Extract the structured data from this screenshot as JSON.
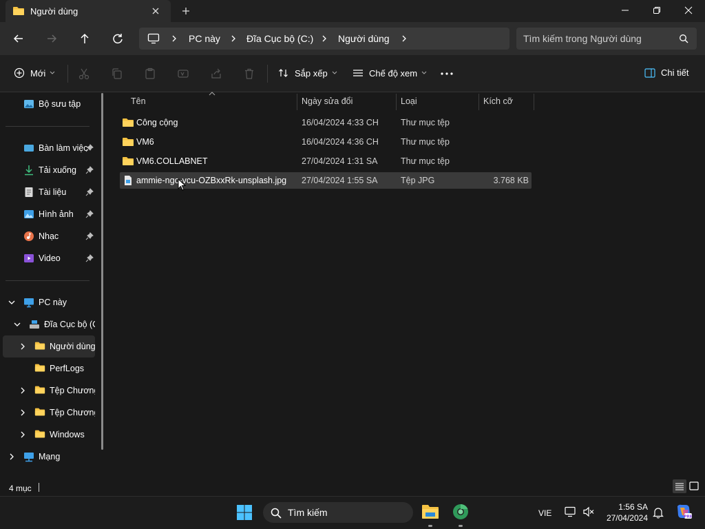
{
  "window": {
    "tab_title": "Người dùng"
  },
  "address": {
    "crumbs": [
      "PC này",
      "Đĩa Cục bộ (C:)",
      "Người dùng"
    ]
  },
  "search": {
    "placeholder": "Tìm kiếm trong Người dùng"
  },
  "toolbar": {
    "new_label": "Mới",
    "sort_label": "Sắp xếp",
    "view_label": "Chế độ xem",
    "details_label": "Chi tiết"
  },
  "sidebar": {
    "gallery": "Bộ sưu tập",
    "quick": [
      {
        "label": "Bàn làm việc"
      },
      {
        "label": "Tải xuống"
      },
      {
        "label": "Tài liệu"
      },
      {
        "label": "Hình ảnh"
      },
      {
        "label": "Nhạc"
      },
      {
        "label": "Video"
      }
    ],
    "this_pc": "PC này",
    "drive": "Đĩa Cục bộ (C:)",
    "folders": [
      {
        "label": "Người dùng"
      },
      {
        "label": "PerfLogs"
      },
      {
        "label": "Tệp Chương"
      },
      {
        "label": "Tệp Chương"
      },
      {
        "label": "Windows"
      }
    ],
    "network": "Mạng"
  },
  "columns": {
    "name": "Tên",
    "modified": "Ngày sửa đổi",
    "type": "Loại",
    "size": "Kích cỡ"
  },
  "files": [
    {
      "name": "Công cộng",
      "modified": "16/04/2024 4:33 CH",
      "type": "Thư mục tệp",
      "size": ""
    },
    {
      "name": "VM6",
      "modified": "16/04/2024 4:36 CH",
      "type": "Thư mục tệp",
      "size": ""
    },
    {
      "name": "VM6.COLLABNET",
      "modified": "27/04/2024 1:31 SA",
      "type": "Thư mục tệp",
      "size": ""
    },
    {
      "name": "ammie-ngo-vcu-OZBxxRk-unsplash.jpg",
      "modified": "27/04/2024 1:55 SA",
      "type": "Tệp JPG",
      "size": "3.768 KB"
    }
  ],
  "status": {
    "count": "4 mục"
  },
  "taskbar": {
    "search_placeholder": "Tìm kiếm",
    "language": "VIE",
    "time": "1:56 SA",
    "date": "27/04/2024"
  },
  "colors": {
    "folder": "#f5c242",
    "accent": "#4cc2ff"
  }
}
